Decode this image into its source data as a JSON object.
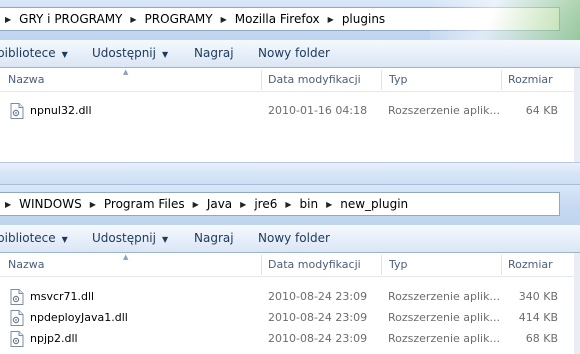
{
  "top": {
    "breadcrumb": [
      "GRY i PROGRAMY",
      "PROGRAMY",
      "Mozilla Firefox",
      "plugins"
    ],
    "toolbar": {
      "library": "bibliotece",
      "share": "Udostępnij",
      "burn": "Nagraj",
      "new_folder": "Nowy folder"
    },
    "columns": {
      "name": "Nazwa",
      "date": "Data modyfikacji",
      "type": "Typ",
      "size": "Rozmiar"
    },
    "files": [
      {
        "name": "npnul32.dll",
        "date": "2010-01-16 04:18",
        "type": "Rozszerzenie aplik...",
        "size": "64 KB"
      }
    ]
  },
  "bottom": {
    "breadcrumb": [
      "WINDOWS",
      "Program Files",
      "Java",
      "jre6",
      "bin",
      "new_plugin"
    ],
    "toolbar": {
      "library": "bibliotece",
      "share": "Udostępnij",
      "burn": "Nagraj",
      "new_folder": "Nowy folder"
    },
    "columns": {
      "name": "Nazwa",
      "date": "Data modyfikacji",
      "type": "Typ",
      "size": "Rozmiar"
    },
    "files": [
      {
        "name": "msvcr71.dll",
        "date": "2010-08-24 23:09",
        "type": "Rozszerzenie aplik...",
        "size": "340 KB"
      },
      {
        "name": "npdeployJava1.dll",
        "date": "2010-08-24 23:09",
        "type": "Rozszerzenie aplik...",
        "size": "414 KB"
      },
      {
        "name": "npjp2.dll",
        "date": "2010-08-24 23:09",
        "type": "Rozszerzenie aplik...",
        "size": "68 KB"
      }
    ]
  },
  "icons": {
    "file": "dll-file-icon",
    "chevron": "breadcrumb-chevron-icon",
    "dropdown": "dropdown-caret-icon"
  }
}
